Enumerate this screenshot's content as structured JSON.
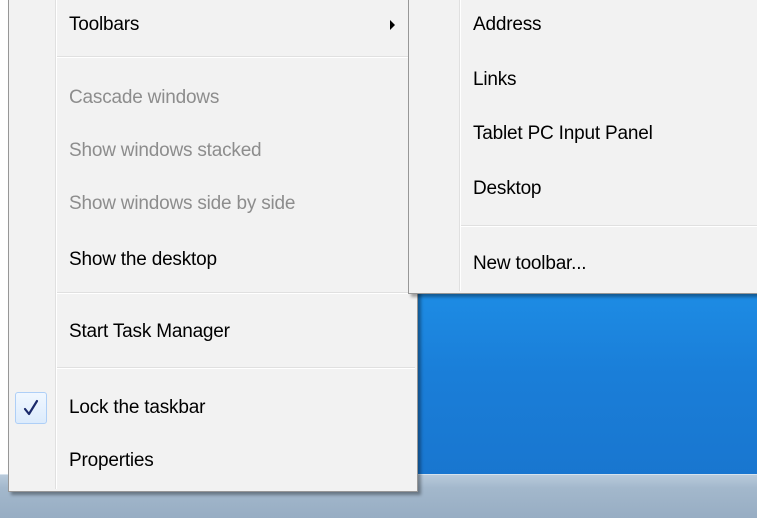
{
  "context_menu": {
    "items": [
      {
        "label": "Toolbars",
        "has_submenu": true,
        "enabled": true
      },
      {
        "label": "Cascade windows",
        "enabled": false
      },
      {
        "label": "Show windows stacked",
        "enabled": false
      },
      {
        "label": "Show windows side by side",
        "enabled": false
      },
      {
        "label": "Show the desktop",
        "enabled": true
      },
      {
        "label": "Start Task Manager",
        "enabled": true
      },
      {
        "label": "Lock the taskbar",
        "enabled": true,
        "checked": true
      },
      {
        "label": "Properties",
        "enabled": true
      }
    ],
    "check_glyph": "✓"
  },
  "toolbars_submenu": {
    "items": [
      {
        "label": "Address"
      },
      {
        "label": "Links"
      },
      {
        "label": "Tablet PC Input Panel"
      },
      {
        "label": "Desktop"
      },
      {
        "label": "New toolbar..."
      }
    ]
  },
  "colors": {
    "desktop_accent": "#1a7ed8",
    "disabled_text": "#8d8d8d",
    "menu_background": "#f2f2f2"
  }
}
